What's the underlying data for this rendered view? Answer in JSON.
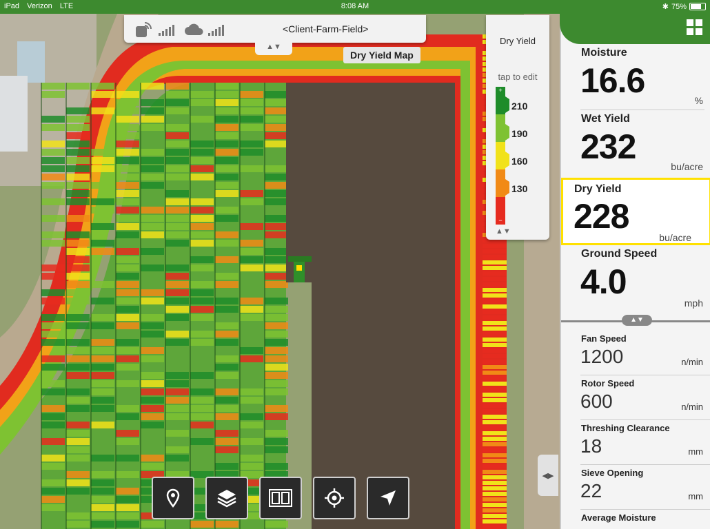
{
  "status_bar": {
    "device": "iPad",
    "carrier": "Verizon",
    "network": "LTE",
    "time": "8:08 AM",
    "battery": "75%"
  },
  "top_panel": {
    "location": "<Client-Farm-Field>"
  },
  "map": {
    "title": "Dry Yield Map"
  },
  "legend": {
    "title": "Dry Yield",
    "tap_text": "tap to edit",
    "thresholds": [
      {
        "value": "210"
      },
      {
        "value": "190"
      },
      {
        "value": "160"
      },
      {
        "value": "130"
      }
    ],
    "colors": [
      "#1e8c2a",
      "#7ec232",
      "#f1e21a",
      "#f18a16",
      "#e62b1f"
    ]
  },
  "toolbar": {
    "icons": [
      "pin-icon",
      "layers-icon",
      "split-view-icon",
      "locate-icon",
      "navigate-arrow-icon"
    ]
  },
  "panel": {
    "primary": [
      {
        "label": "Moisture",
        "value": "16.6",
        "unit": "%"
      },
      {
        "label": "Wet Yield",
        "value": "232",
        "unit": "bu/acre"
      },
      {
        "label": "Dry Yield",
        "value": "228",
        "unit": "bu/acre",
        "selected": true
      },
      {
        "label": "Ground Speed",
        "value": "4.0",
        "unit": "mph"
      }
    ],
    "secondary": [
      {
        "label": "Fan Speed",
        "value": "1200",
        "unit": "n/min"
      },
      {
        "label": "Rotor Speed",
        "value": "600",
        "unit": "n/min"
      },
      {
        "label": "Threshing Clearance",
        "value": "18",
        "unit": "mm"
      },
      {
        "label": "Sieve Opening",
        "value": "22",
        "unit": "mm"
      },
      {
        "label": "Average Moisture"
      }
    ]
  },
  "colors": {
    "accent": "#3d8a2f",
    "selected_border": "#ffe100"
  }
}
